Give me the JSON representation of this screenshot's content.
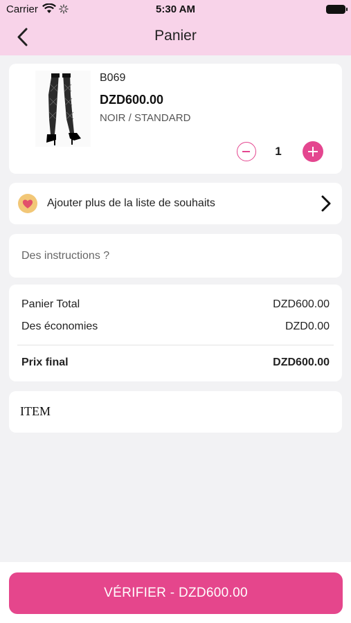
{
  "status_bar": {
    "carrier": "Carrier",
    "time": "5:30 AM"
  },
  "nav": {
    "title": "Panier",
    "back_icon": "chevron-left-icon"
  },
  "cart_item": {
    "sku": "B069",
    "price": "DZD600.00",
    "variant": "NOIR / STANDARD",
    "quantity": "1"
  },
  "wishlist": {
    "label": "Ajouter plus de la liste de souhaits",
    "icon": "heart-icon",
    "icon_color": "#f2c777"
  },
  "notes": {
    "placeholder": "Des instructions ?"
  },
  "summary": {
    "cart_total_label": "Panier Total",
    "cart_total_value": "DZD600.00",
    "savings_label": "Des économies",
    "savings_value": "DZD0.00",
    "final_label": "Prix final",
    "final_value": "DZD600.00"
  },
  "item_section": {
    "text": "ITEM"
  },
  "checkout": {
    "label": "VÉRIFIER - DZD600.00"
  },
  "colors": {
    "accent": "#e5468c",
    "header_bg": "#f8d3e9",
    "page_bg": "#f2f2f4"
  }
}
